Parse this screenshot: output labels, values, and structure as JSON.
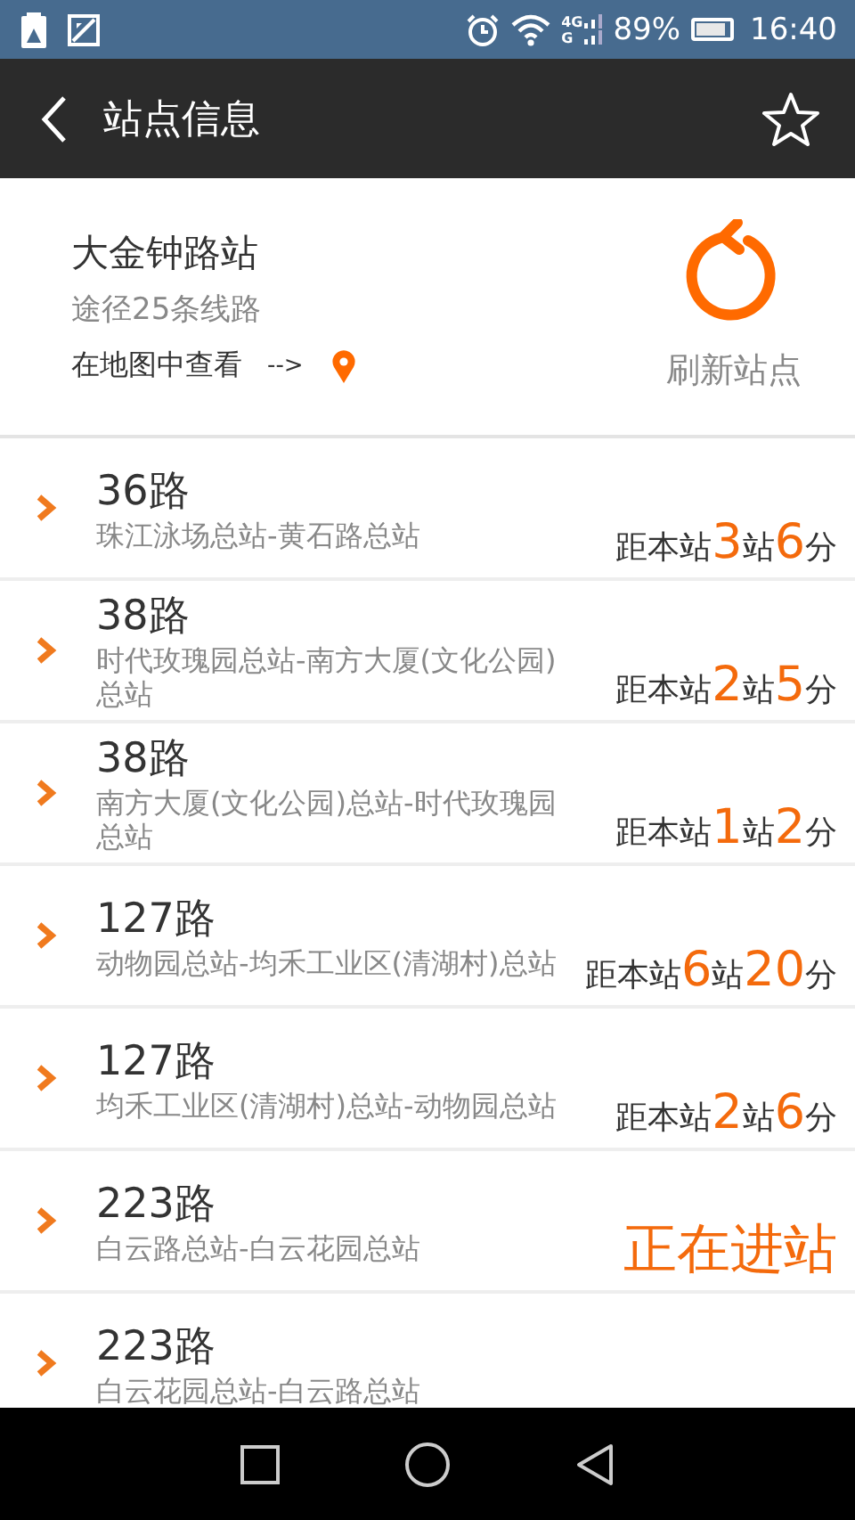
{
  "status_bar": {
    "network": [
      "4G",
      "G"
    ],
    "battery_text": "89%",
    "time": "16:40"
  },
  "header": {
    "title": "站点信息",
    "favorite": false
  },
  "station": {
    "name": "大金钟路站",
    "lines_count": "途径25条线路",
    "map_link": "在地图中查看",
    "map_arrow": "-->",
    "refresh_label": "刷新站点"
  },
  "lines": [
    {
      "name": "36路",
      "route": "珠江泳场总站-黄石路总站",
      "kind": "eta",
      "eta": {
        "prefix": "距本站",
        "stops": "3",
        "stops_unit": "站",
        "minutes": "6",
        "minutes_unit": "分"
      }
    },
    {
      "name": "38路",
      "route": "时代玫瑰园总站-南方大厦(文化公园)总站",
      "kind": "eta",
      "eta": {
        "prefix": "距本站",
        "stops": "2",
        "stops_unit": "站",
        "minutes": "5",
        "minutes_unit": "分"
      }
    },
    {
      "name": "38路",
      "route": "南方大厦(文化公园)总站-时代玫瑰园总站",
      "kind": "eta",
      "eta": {
        "prefix": "距本站",
        "stops": "1",
        "stops_unit": "站",
        "minutes": "2",
        "minutes_unit": "分"
      }
    },
    {
      "name": "127路",
      "route": "动物园总站-均禾工业区(清湖村)总站",
      "kind": "eta",
      "eta": {
        "prefix": "距本站",
        "stops": "6",
        "stops_unit": "站",
        "minutes": "20",
        "minutes_unit": "分"
      }
    },
    {
      "name": "127路",
      "route": "均禾工业区(清湖村)总站-动物园总站",
      "kind": "eta",
      "eta": {
        "prefix": "距本站",
        "stops": "2",
        "stops_unit": "站",
        "minutes": "6",
        "minutes_unit": "分"
      }
    },
    {
      "name": "223路",
      "route": "白云路总站-白云花园总站",
      "kind": "arriving",
      "status": "正在进站"
    },
    {
      "name": "223路",
      "route": "白云花园总站-白云路总站"
    }
  ]
}
